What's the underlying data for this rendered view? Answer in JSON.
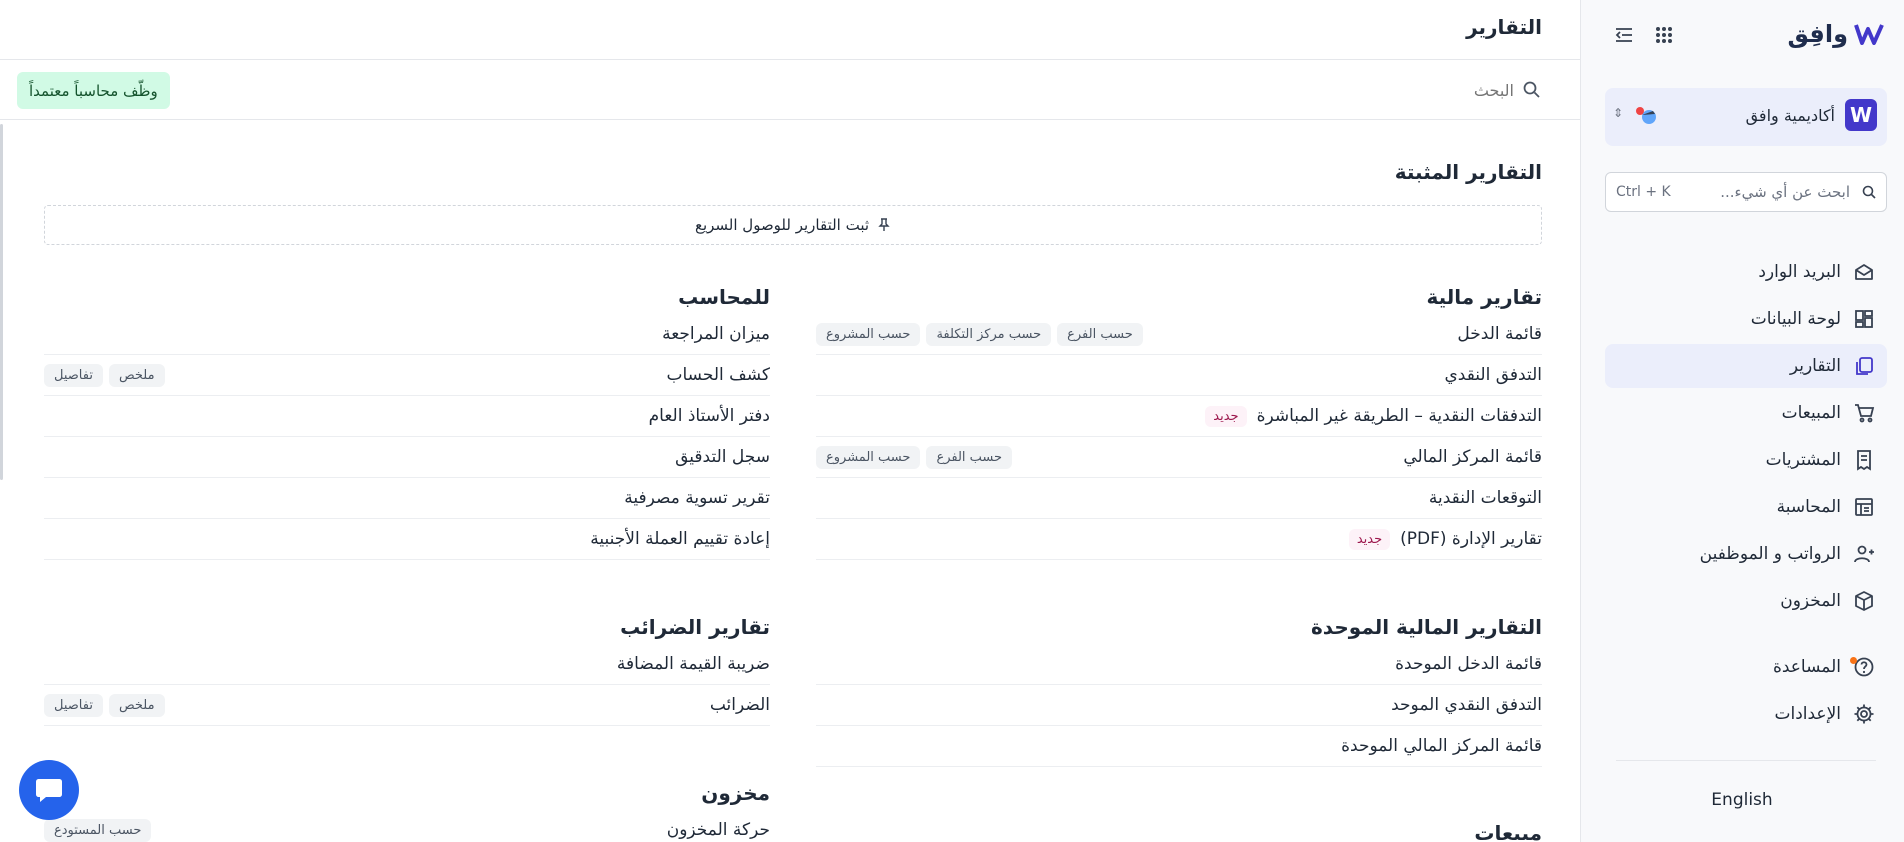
{
  "sidebar": {
    "logo_text": "وافِق",
    "org": {
      "name": "أكاديمية وافق",
      "logo_letter": "W"
    },
    "search": {
      "placeholder": "ابحث عن أي شيء...",
      "shortcut": "Ctrl + K"
    },
    "nav": [
      {
        "label": "البريد الوارد",
        "icon": "inbox-icon"
      },
      {
        "label": "لوحة البيانات",
        "icon": "dashboard-icon"
      },
      {
        "label": "التقارير",
        "icon": "reports-icon",
        "active": true
      },
      {
        "label": "المبيعات",
        "icon": "cart-icon"
      },
      {
        "label": "المشتريات",
        "icon": "receipt-icon"
      },
      {
        "label": "المحاسبة",
        "icon": "accounting-icon"
      },
      {
        "label": "الرواتب و الموظفين",
        "icon": "users-icon"
      },
      {
        "label": "المخزون",
        "icon": "box-icon"
      }
    ],
    "help_label": "المساعدة",
    "settings_label": "الإعدادات",
    "language": "English"
  },
  "main": {
    "title": "التقارير",
    "search_placeholder": "البحث",
    "hire_button": "وظّف محاسباً معتمداً",
    "pinned_title": "التقارير المثبتة",
    "pinned_hint": "ثبت التقارير للوصول السريع",
    "new_badge": "جديد",
    "financial": {
      "title": "تقارير مالية",
      "rows": [
        {
          "label": "قائمة الدخل",
          "chips": [
            "حسب الفرع",
            "حسب مركز التكلفة",
            "حسب المشروع"
          ]
        },
        {
          "label": "التدفق النقدي"
        },
        {
          "label": "التدفقات النقدية – الطريقة غير المباشرة",
          "badge": "جديد"
        },
        {
          "label": "قائمة المركز المالي",
          "chips": [
            "حسب الفرع",
            "حسب المشروع"
          ]
        },
        {
          "label": "التوقعات النقدية"
        },
        {
          "label": "تقارير الإدارة (PDF)",
          "badge": "جديد"
        }
      ]
    },
    "consolidated": {
      "title": "التقارير المالية الموحدة",
      "rows": [
        {
          "label": "قائمة الدخل الموحدة"
        },
        {
          "label": "التدفق النقدي الموحد"
        },
        {
          "label": "قائمة المركز المالي الموحدة"
        }
      ]
    },
    "sales_title": "مبيعات",
    "accountant": {
      "title": "للمحاسب",
      "rows": [
        {
          "label": "ميزان المراجعة"
        },
        {
          "label": "كشف الحساب",
          "chips": [
            "ملخص",
            "تفاصيل"
          ]
        },
        {
          "label": "دفتر الأستاذ العام"
        },
        {
          "label": "سجل التدقيق"
        },
        {
          "label": "تقرير تسوية مصرفية"
        },
        {
          "label": "إعادة تقييم العملة الأجنبية"
        }
      ]
    },
    "tax": {
      "title": "تقارير الضرائب",
      "rows": [
        {
          "label": "ضريبة القيمة المضافة"
        },
        {
          "label": "الضرائب",
          "chips": [
            "ملخص",
            "تفاصيل"
          ]
        }
      ]
    },
    "inventory": {
      "title": "مخزون",
      "rows": [
        {
          "label": "حركة المخزون",
          "chips": [
            "حسب المستودع"
          ]
        }
      ]
    }
  },
  "colors": {
    "accent": "#4338ca",
    "active_bg": "#ebeefb",
    "hire_bg": "#d1fae5",
    "chat": "#2563eb"
  }
}
